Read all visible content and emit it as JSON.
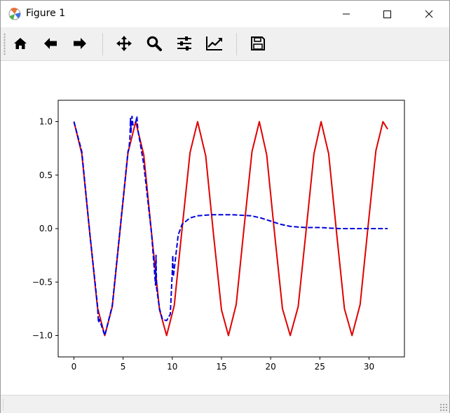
{
  "window": {
    "title": "Figure 1",
    "buttons": [
      "minimize",
      "maximize",
      "close"
    ]
  },
  "toolbar": {
    "tools": [
      {
        "name": "home",
        "icon": "home-icon"
      },
      {
        "name": "back",
        "icon": "arrow-left-icon"
      },
      {
        "name": "forward",
        "icon": "arrow-right-icon"
      },
      {
        "name": "pan",
        "icon": "move-icon"
      },
      {
        "name": "zoom",
        "icon": "zoom-icon"
      },
      {
        "name": "configure-subplots",
        "icon": "sliders-icon"
      },
      {
        "name": "edit-axis",
        "icon": "chart-line-icon"
      },
      {
        "name": "save",
        "icon": "save-icon"
      }
    ]
  },
  "colors": {
    "series_red": "#e00000",
    "series_blue": "#0000dd"
  },
  "chart_data": {
    "type": "line",
    "title": "",
    "xlabel": "",
    "ylabel": "",
    "xlim": [
      -1.6,
      33.6
    ],
    "ylim": [
      -1.2,
      1.2
    ],
    "xticks": [
      0,
      5,
      10,
      15,
      20,
      25,
      30
    ],
    "xtick_labels": [
      "0",
      "5",
      "10",
      "15",
      "20",
      "25",
      "30"
    ],
    "yticks": [
      1.0,
      0.5,
      0.0,
      -0.5,
      -1.0
    ],
    "ytick_labels": [
      "1.0",
      "0.5",
      "0.0",
      "−0.5",
      "−1.0"
    ],
    "grid": false,
    "series": [
      {
        "style": "solid",
        "color": "#e00000",
        "x": [
          0,
          0.8,
          1.6,
          2.4,
          3.14,
          3.9,
          4.7,
          5.5,
          6.28,
          7.1,
          7.9,
          8.7,
          9.42,
          10.2,
          11.0,
          11.8,
          12.57,
          13.4,
          14.2,
          15.0,
          15.71,
          16.5,
          17.3,
          18.1,
          18.85,
          19.6,
          20.4,
          21.2,
          21.99,
          22.8,
          23.6,
          24.4,
          25.13,
          25.9,
          26.7,
          27.5,
          28.27,
          29.1,
          29.9,
          30.7,
          31.42,
          31.9
        ],
        "y": [
          1.0,
          0.7,
          -0.03,
          -0.74,
          -1.0,
          -0.73,
          -0.01,
          0.71,
          1.0,
          0.69,
          -0.05,
          -0.76,
          -1.0,
          -0.72,
          0.0,
          0.71,
          1.0,
          0.68,
          -0.06,
          -0.76,
          -1.0,
          -0.71,
          0.01,
          0.72,
          1.0,
          0.69,
          -0.05,
          -0.75,
          -1.0,
          -0.73,
          -0.02,
          0.7,
          1.0,
          0.7,
          -0.04,
          -0.75,
          -1.0,
          -0.71,
          0.02,
          0.73,
          1.0,
          0.93
        ]
      },
      {
        "style": "dashed",
        "color": "#0000dd",
        "x": [
          0,
          0.8,
          1.6,
          2.4,
          2.5,
          2.6,
          3.14,
          3.9,
          4.7,
          5.5,
          5.6,
          5.7,
          5.75,
          5.8,
          5.9,
          6.0,
          6.3,
          6.4,
          6.5,
          6.7,
          7.1,
          7.9,
          8.3,
          8.35,
          8.4,
          8.7,
          9.0,
          9.42,
          9.8,
          10.0,
          10.05,
          10.1,
          10.2,
          10.3,
          10.6,
          11.0,
          11.8,
          12.6,
          14.0,
          16.0,
          18.0,
          19.0,
          20.0,
          21.0,
          22.0,
          23.5,
          25.0,
          27.0,
          29.0,
          31.0,
          31.9
        ],
        "y": [
          1.0,
          0.72,
          -0.03,
          -0.72,
          -0.88,
          -0.85,
          -1.0,
          -0.72,
          0.0,
          0.72,
          0.75,
          0.85,
          1.03,
          0.9,
          1.05,
          0.97,
          1.0,
          1.05,
          0.92,
          0.82,
          0.6,
          -0.05,
          -0.53,
          -0.25,
          -0.55,
          -0.75,
          -0.85,
          -0.86,
          -0.8,
          -0.4,
          -0.25,
          -0.45,
          -0.38,
          -0.3,
          -0.06,
          0.04,
          0.1,
          0.12,
          0.13,
          0.13,
          0.12,
          0.1,
          0.07,
          0.04,
          0.02,
          0.01,
          0.01,
          0.0,
          0.0,
          0.0,
          0.0
        ]
      }
    ]
  }
}
